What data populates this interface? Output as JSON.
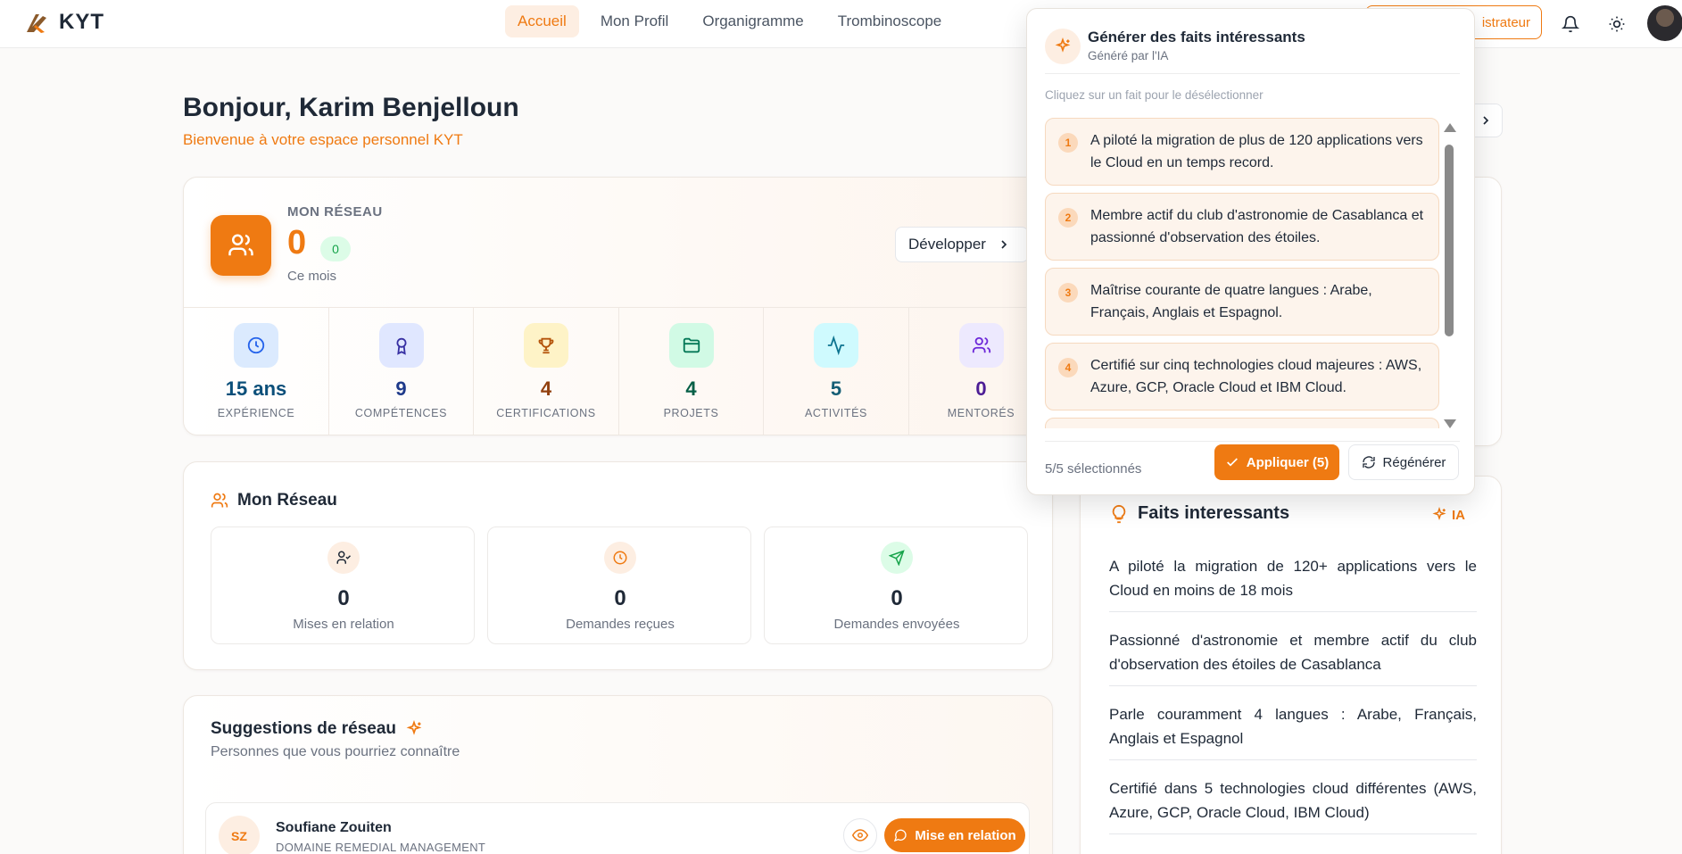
{
  "app": {
    "name": "KYT"
  },
  "nav": {
    "items": [
      {
        "label": "Accueil"
      },
      {
        "label": "Mon Profil"
      },
      {
        "label": "Organigramme"
      },
      {
        "label": "Trombinoscope"
      }
    ],
    "admin_label": "istrateur"
  },
  "greeting": {
    "title": "Bonjour, Karim Benjelloun",
    "subtitle": "Bienvenue à votre espace personnel KYT"
  },
  "network": {
    "label": "MON RÉSEAU",
    "count": "0",
    "badge": "0",
    "period": "Ce mois",
    "expand_label": "Développer",
    "stats": [
      {
        "value": "15 ans",
        "label": "EXPÉRIENCE",
        "color": "#0b4f7a"
      },
      {
        "value": "9",
        "label": "COMPÉTENCES",
        "color": "#1e3a8a"
      },
      {
        "value": "4",
        "label": "CERTIFICATIONS",
        "color": "#92400e"
      },
      {
        "value": "4",
        "label": "PROJETS",
        "color": "#065f46"
      },
      {
        "value": "5",
        "label": "ACTIVITÉS",
        "color": "#155e75"
      },
      {
        "value": "0",
        "label": "MENTORÉS",
        "color": "#4c1d95"
      }
    ]
  },
  "reseau": {
    "title": "Mon Réseau",
    "items": [
      {
        "value": "0",
        "label": "Mises en relation"
      },
      {
        "value": "0",
        "label": "Demandes reçues"
      },
      {
        "value": "0",
        "label": "Demandes envoyées"
      }
    ]
  },
  "suggestions": {
    "title": "Suggestions de réseau",
    "subtitle": "Personnes que vous pourriez connaître",
    "people": [
      {
        "initials": "SZ",
        "name": "Soufiane Zouiten",
        "department": "DOMAINE REMEDIAL MANAGEMENT",
        "action_label": "Mise en relation"
      }
    ]
  },
  "faits": {
    "title": "Faits interessants",
    "ia_label": "IA",
    "items": [
      "A piloté la migration de 120+ applications vers le Cloud en moins de 18 mois",
      "Passionné d'astronomie et membre actif du club d'observation des étoiles de Casablanca",
      "Parle couramment 4 langues : Arabe, Français, Anglais et Espagnol",
      "Certifié dans 5 technologies cloud différentes (AWS, Azure, GCP, Oracle Cloud, IBM Cloud)"
    ]
  },
  "popover": {
    "title": "Générer des faits intéressants",
    "subtitle": "Généré par l'IA",
    "hint": "Cliquez sur un fait pour le désélectionner",
    "facts": [
      {
        "num": "1",
        "text": "A piloté la migration de plus de 120 applications vers le Cloud en un temps record."
      },
      {
        "num": "2",
        "text": "Membre actif du club d'astronomie de Casablanca et passionné d'observation des étoiles."
      },
      {
        "num": "3",
        "text": "Maîtrise courante de quatre langues : Arabe, Français, Anglais et Espagnol."
      },
      {
        "num": "4",
        "text": "Certifié sur cinq technologies cloud majeures : AWS, Azure, GCP, Oracle Cloud et IBM Cloud."
      }
    ],
    "selection_count": "5/5 sélectionnés",
    "apply_label": "Appliquer (5)",
    "regen_label": "Régénérer"
  },
  "colors": {
    "accent": "#ef7a12",
    "accent_soft": "#fdeee2"
  }
}
